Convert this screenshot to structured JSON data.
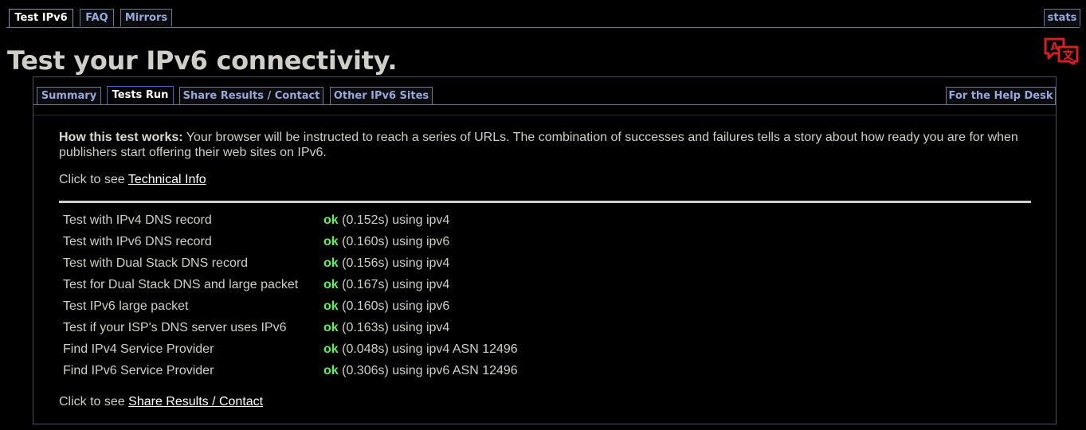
{
  "top_tabs": [
    {
      "label": "Test IPv6",
      "active": true
    },
    {
      "label": "FAQ",
      "active": false
    },
    {
      "label": "Mirrors",
      "active": false
    }
  ],
  "stats_tab": "stats",
  "page_title": "Test your IPv6 connectivity.",
  "translate_icon": "translate-icon",
  "inner_tabs": [
    {
      "label": "Summary",
      "active": false
    },
    {
      "label": "Tests Run",
      "active": true
    },
    {
      "label": "Share Results / Contact",
      "active": false
    },
    {
      "label": "Other IPv6 Sites",
      "active": false
    }
  ],
  "help_desk_tab": "For the Help Desk",
  "intro": {
    "bold": "How this test works:",
    "text": " Your browser will be instructed to reach a series of URLs. The combination of successes and failures tells a story about how ready you are for when publishers start offering their web sites on IPv6."
  },
  "tech_info": {
    "prefix": "Click to see ",
    "link": "Technical Info"
  },
  "results": [
    {
      "name": "Test with IPv4 DNS record",
      "status": "ok",
      "detail": " (0.152s) using ipv4"
    },
    {
      "name": "Test with IPv6 DNS record",
      "status": "ok",
      "detail": " (0.160s) using ipv6"
    },
    {
      "name": "Test with Dual Stack DNS record",
      "status": "ok",
      "detail": " (0.156s) using ipv4"
    },
    {
      "name": "Test for Dual Stack DNS and large packet",
      "status": "ok",
      "detail": " (0.167s) using ipv4"
    },
    {
      "name": "Test IPv6 large packet",
      "status": "ok",
      "detail": " (0.160s) using ipv6"
    },
    {
      "name": "Test if your ISP's DNS server uses IPv6",
      "status": "ok",
      "detail": " (0.163s) using ipv4"
    },
    {
      "name": "Find IPv4 Service Provider",
      "status": "ok",
      "detail": " (0.048s) using ipv4 ASN 12496"
    },
    {
      "name": "Find IPv6 Service Provider",
      "status": "ok",
      "detail": " (0.306s) using ipv6 ASN 12496"
    }
  ],
  "share": {
    "prefix": "Click to see ",
    "link": "Share Results / Contact"
  },
  "colors": {
    "ok": "#5df15d",
    "tab_text": "#95a8d8",
    "title": "#cfcfc7",
    "icon_red": "#d42020"
  }
}
